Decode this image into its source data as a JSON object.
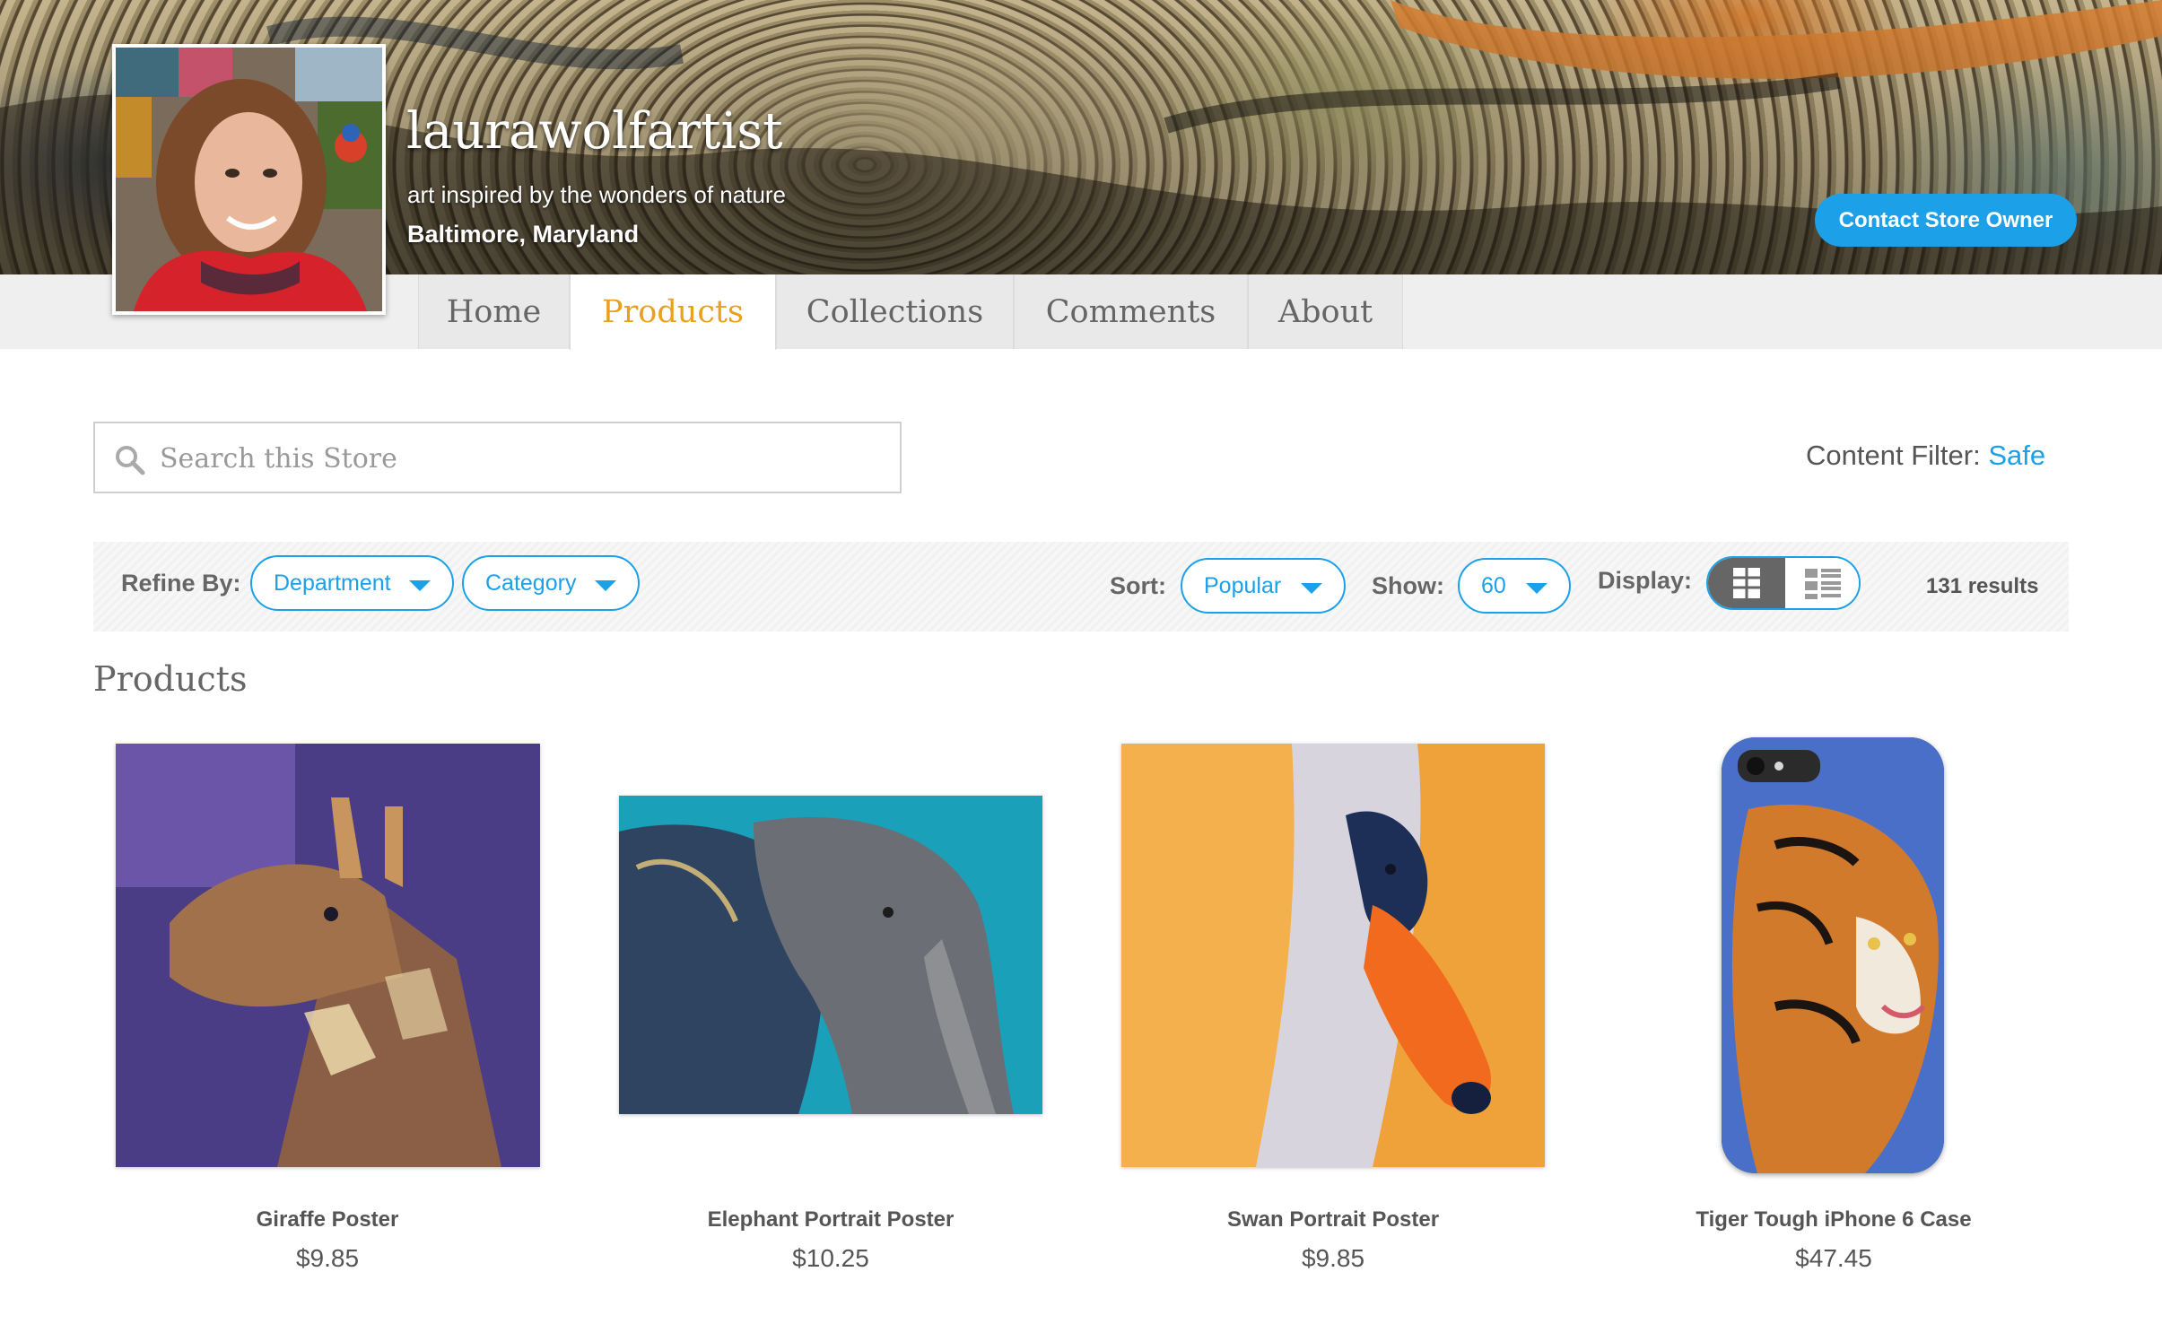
{
  "store": {
    "name": "laurawolfartist",
    "tagline": "art inspired by the wonders of nature",
    "location": "Baltimore, Maryland",
    "contact_label": "Contact Store Owner"
  },
  "nav": {
    "tabs": [
      {
        "label": "Home"
      },
      {
        "label": "Products",
        "active": true
      },
      {
        "label": "Collections"
      },
      {
        "label": "Comments"
      },
      {
        "label": "About"
      }
    ]
  },
  "search": {
    "placeholder": "Search this Store"
  },
  "content_filter": {
    "label": "Content Filter:",
    "value": "Safe"
  },
  "refine": {
    "label": "Refine By:",
    "department": "Department",
    "category": "Category"
  },
  "sort": {
    "label": "Sort:",
    "value": "Popular"
  },
  "show": {
    "label": "Show:",
    "value": "60"
  },
  "display": {
    "label": "Display:",
    "mode": "grid"
  },
  "results": "131 results",
  "section_title": "Products",
  "products": [
    {
      "name": "Giraffe Poster",
      "price": "$9.85"
    },
    {
      "name": "Elephant Portrait Poster",
      "price": "$10.25"
    },
    {
      "name": "Swan Portrait Poster",
      "price": "$9.85"
    },
    {
      "name": "Tiger Tough iPhone 6 Case",
      "price": "$47.45"
    }
  ],
  "colors": {
    "accent": "#1ca0e8",
    "active_tab": "#e9a11d"
  }
}
